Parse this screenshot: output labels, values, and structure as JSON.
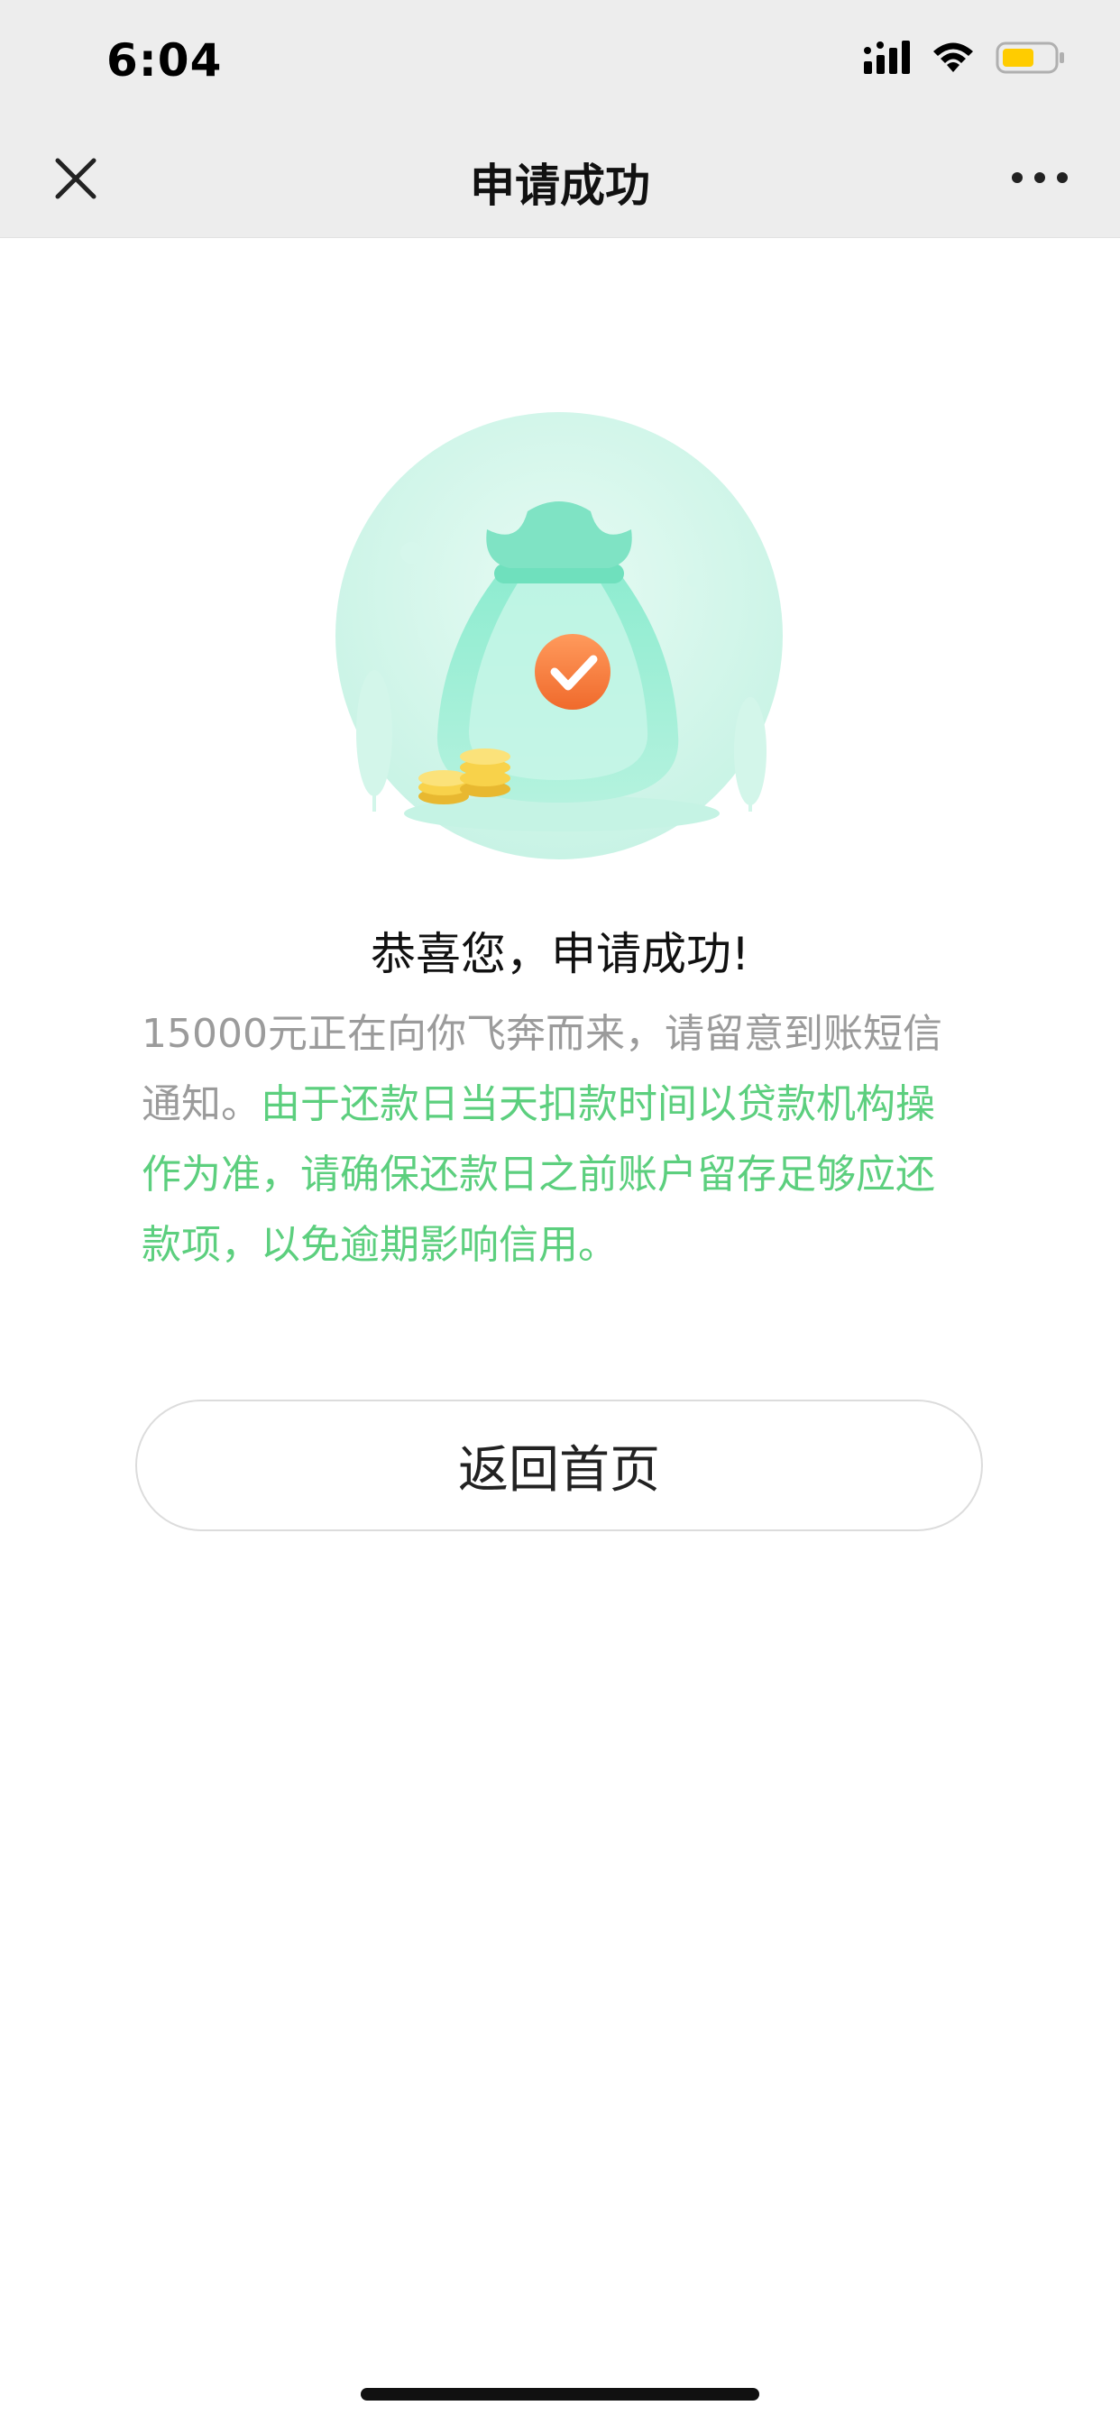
{
  "status_bar": {
    "time": "6:04",
    "icons": [
      "signal-icon",
      "wifi-icon",
      "battery-icon"
    ],
    "battery_color": "#ffcc00"
  },
  "nav": {
    "title": "申请成功",
    "close_icon": "close-icon",
    "more_icon": "more-icon"
  },
  "illustration": {
    "icon": "money-bag-success-icon",
    "accent": "#7fe3c4",
    "check_color": "#f47a3a",
    "coin_color": "#f8d24a"
  },
  "result": {
    "headline": "恭喜您，申请成功!",
    "message_gray": "15000元正在向你飞奔而来，请留意到账短信通知。",
    "message_green": "由于还款日当天扣款时间以贷款机构操作为准，请确保还款日之前账户留存足够应还款项，以免逾期影响信用。"
  },
  "actions": {
    "home_button_label": "返回首页"
  },
  "colors": {
    "header_bg": "#ededed",
    "highlight_green": "#5ccf7e",
    "muted_text": "#9b9b9b"
  }
}
